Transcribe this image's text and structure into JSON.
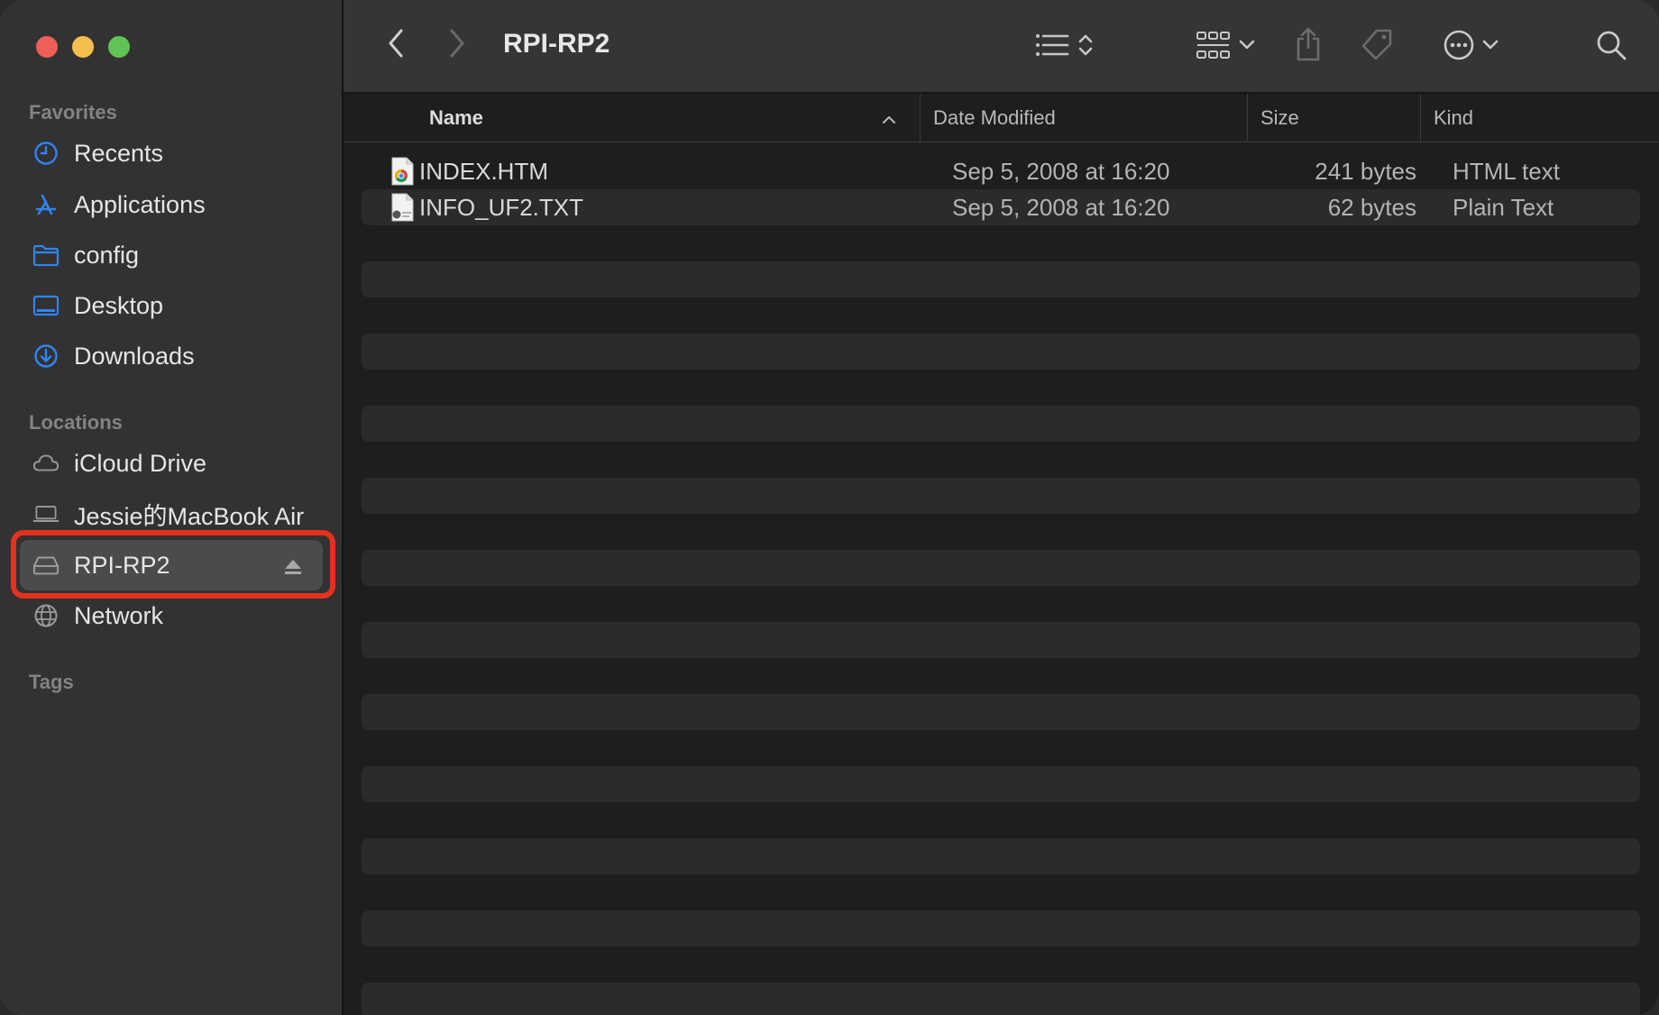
{
  "window": {
    "title": "RPI-RP2"
  },
  "sidebar": {
    "favorites_title": "Favorites",
    "favorites": [
      {
        "label": "Recents",
        "icon": "clock-icon"
      },
      {
        "label": "Applications",
        "icon": "applications-icon"
      },
      {
        "label": "config",
        "icon": "folder-icon"
      },
      {
        "label": "Desktop",
        "icon": "desktop-icon"
      },
      {
        "label": "Downloads",
        "icon": "download-icon"
      }
    ],
    "locations_title": "Locations",
    "locations": [
      {
        "label": "iCloud Drive",
        "icon": "cloud-icon"
      },
      {
        "label": "Jessie的MacBook Air",
        "icon": "laptop-icon"
      },
      {
        "label": "RPI-RP2",
        "icon": "drive-icon",
        "selected": true
      },
      {
        "label": "Network",
        "icon": "globe-icon"
      }
    ],
    "tags_title": "Tags"
  },
  "table": {
    "columns": {
      "name": "Name",
      "date": "Date Modified",
      "size": "Size",
      "kind": "Kind"
    },
    "rows": [
      {
        "name": "INDEX.HTM",
        "date": "Sep 5, 2008 at 16:20",
        "size": "241 bytes",
        "kind": "HTML text",
        "icon": "html-file-icon"
      },
      {
        "name": "INFO_UF2.TXT",
        "date": "Sep 5, 2008 at 16:20",
        "size": "62 bytes",
        "kind": "Plain Text",
        "icon": "text-file-icon"
      }
    ]
  },
  "colors": {
    "accent": "#2f84f5",
    "highlight": "#e4321e",
    "close": "#ed5f57",
    "minimize": "#f5bf4f",
    "zoom": "#5fc454"
  }
}
